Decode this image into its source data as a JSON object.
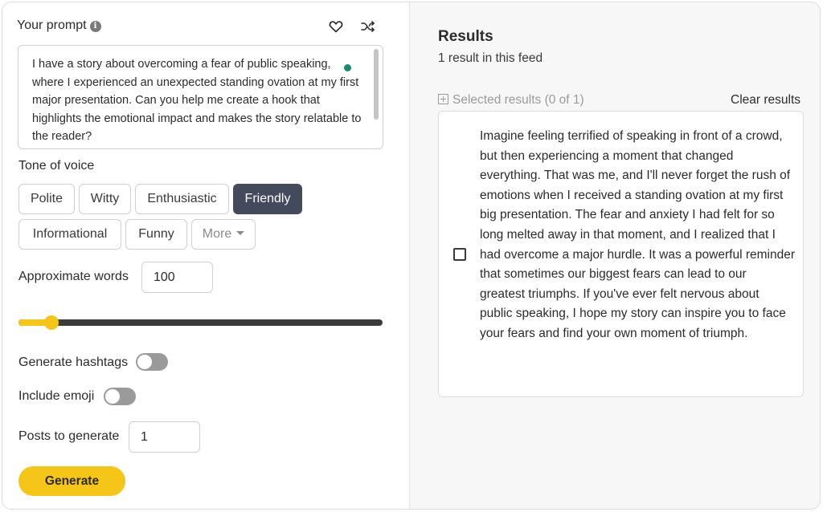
{
  "prompt": {
    "label": "Your prompt",
    "info_icon": "info-icon",
    "text": "I have a story about overcoming a fear of public speaking, where I experienced an unexpected standing ovation at my first major presentation. Can you help me create a hook that highlights the emotional impact and makes the story relatable to the reader?"
  },
  "tone": {
    "label": "Tone of voice",
    "options": [
      "Polite",
      "Witty",
      "Enthusiastic",
      "Friendly",
      "Informational",
      "Funny"
    ],
    "selected": "Friendly",
    "more_label": "More"
  },
  "words": {
    "label": "Approximate words",
    "value": "100",
    "slider_fraction": 0.09
  },
  "hashtags": {
    "label": "Generate hashtags",
    "enabled": false
  },
  "emoji": {
    "label": "Include emoji",
    "enabled": false
  },
  "posts": {
    "label": "Posts to generate",
    "value": "1"
  },
  "generate_label": "Generate",
  "results": {
    "title": "Results",
    "count_text": "1 result in this feed",
    "selected_text": "Selected results (0 of 1)",
    "clear_label": "Clear results",
    "items": [
      {
        "text": "Imagine feeling terrified of speaking in front of a crowd, but then experiencing a moment that changed everything. That was me, and I'll never forget the rush of emotions when I received a standing ovation at my first big presentation. The fear and anxiety I had felt for so long melted away in that moment, and I realized that I had overcome a major hurdle. It was a powerful reminder that sometimes our biggest fears can lead to our greatest triumphs. If you've ever felt nervous about public speaking, I hope my story can inspire you to face your fears and find your own moment of triumph.",
        "checked": false
      }
    ]
  },
  "colors": {
    "accent": "#f5c518",
    "chip_active": "#434a5c",
    "toggle_off": "#9a9a9a",
    "grammar_dot": "#178a6f"
  }
}
